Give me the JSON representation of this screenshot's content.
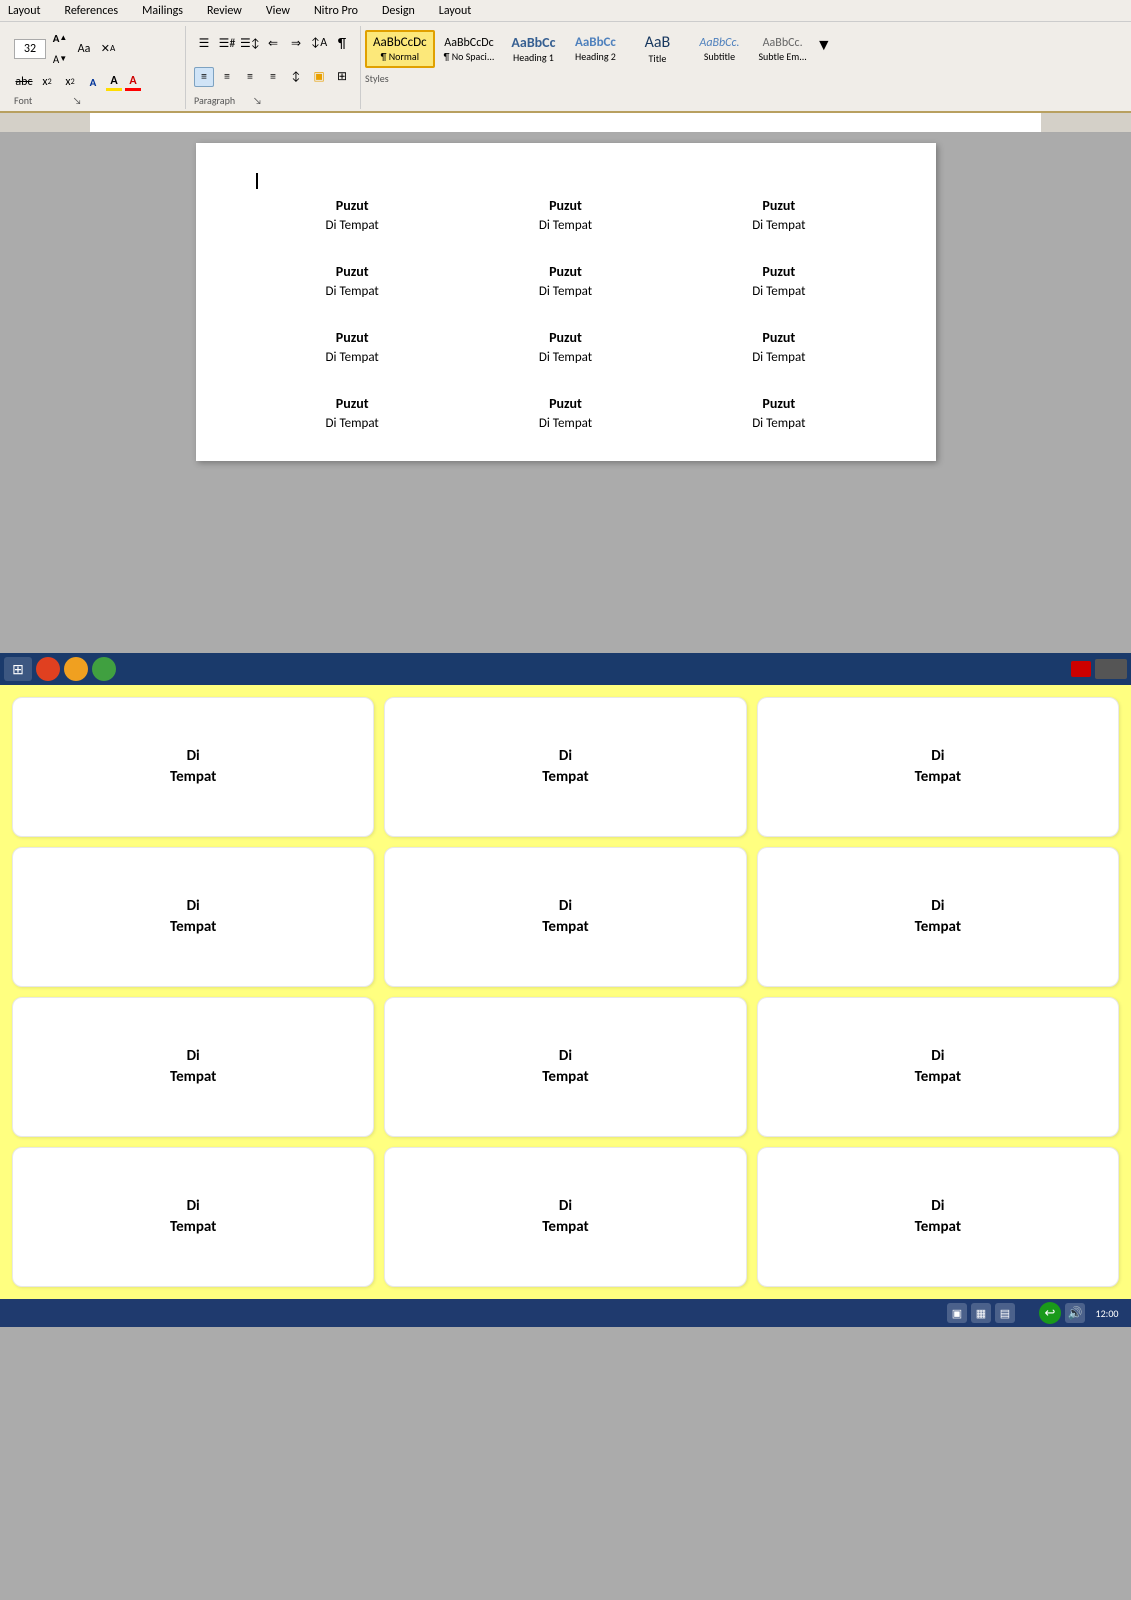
{
  "menu": {
    "items": [
      "Layout",
      "References",
      "Mailings",
      "Review",
      "View",
      "Nitro Pro",
      "Design",
      "Layout"
    ]
  },
  "ribbon": {
    "font_size": "32",
    "font_size_up": "A↑",
    "font_size_down": "A↓",
    "font_case": "Aa",
    "clear_format": "✕",
    "paragraph_section_label": "Paragraph",
    "font_section_label": "Font",
    "styles_section_label": "Styles"
  },
  "styles": [
    {
      "id": "normal",
      "label": "¶ Normal",
      "active": true,
      "sample": "AaBbCcDc"
    },
    {
      "id": "nospace",
      "label": "¶ No Spaci...",
      "active": false,
      "sample": "AaBbCcDc"
    },
    {
      "id": "h1",
      "label": "Heading 1",
      "active": false,
      "sample": "AaBbCc"
    },
    {
      "id": "h2",
      "label": "Heading 2",
      "active": false,
      "sample": "AaBbCc"
    },
    {
      "id": "title",
      "label": "Title",
      "active": false,
      "sample": "AaB"
    },
    {
      "id": "subtitle",
      "label": "Subtitle",
      "active": false,
      "sample": "AaBbCc."
    },
    {
      "id": "subtle",
      "label": "Subtle Em...",
      "active": false,
      "sample": "AaBbCc."
    }
  ],
  "document": {
    "rows": [
      [
        {
          "title": "Puzut",
          "subtitle": "Di Tempat"
        },
        {
          "title": "Puzut",
          "subtitle": "Di Tempat"
        },
        {
          "title": "Puzut",
          "subtitle": "Di Tempat"
        }
      ],
      [
        {
          "title": "Puzut",
          "subtitle": "Di Tempat"
        },
        {
          "title": "Puzut",
          "subtitle": "Di Tempat"
        },
        {
          "title": "Puzut",
          "subtitle": "Di Tempat"
        }
      ],
      [
        {
          "title": "Puzut",
          "subtitle": "Di Tempat"
        },
        {
          "title": "Puzut",
          "subtitle": "Di Tempat"
        },
        {
          "title": "Puzut",
          "subtitle": "Di Tempat"
        }
      ],
      [
        {
          "title": "Puzut",
          "subtitle": "Di Tempat"
        },
        {
          "title": "Puzut",
          "subtitle": "Di Tempat"
        },
        {
          "title": "Puzut",
          "subtitle": "Di Tempat"
        }
      ]
    ]
  },
  "labels": {
    "rows": [
      [
        {
          "text": "Di\nTempat"
        },
        {
          "text": "Di\nTempat"
        },
        {
          "text": "Di\nTempat"
        }
      ],
      [
        {
          "text": "Di\nTempat"
        },
        {
          "text": "Di\nTempat"
        },
        {
          "text": "Di\nTempat"
        }
      ],
      [
        {
          "text": "Di\nTempat"
        },
        {
          "text": "Di\nTempat"
        },
        {
          "text": "Di\nTempat"
        }
      ],
      [
        {
          "text": "Di\nTempat"
        },
        {
          "text": "Di\nTempat"
        },
        {
          "text": "Di\nTempat"
        }
      ]
    ]
  },
  "taskbar": {
    "start_icon": "⊞",
    "app_icon": "🔵"
  }
}
